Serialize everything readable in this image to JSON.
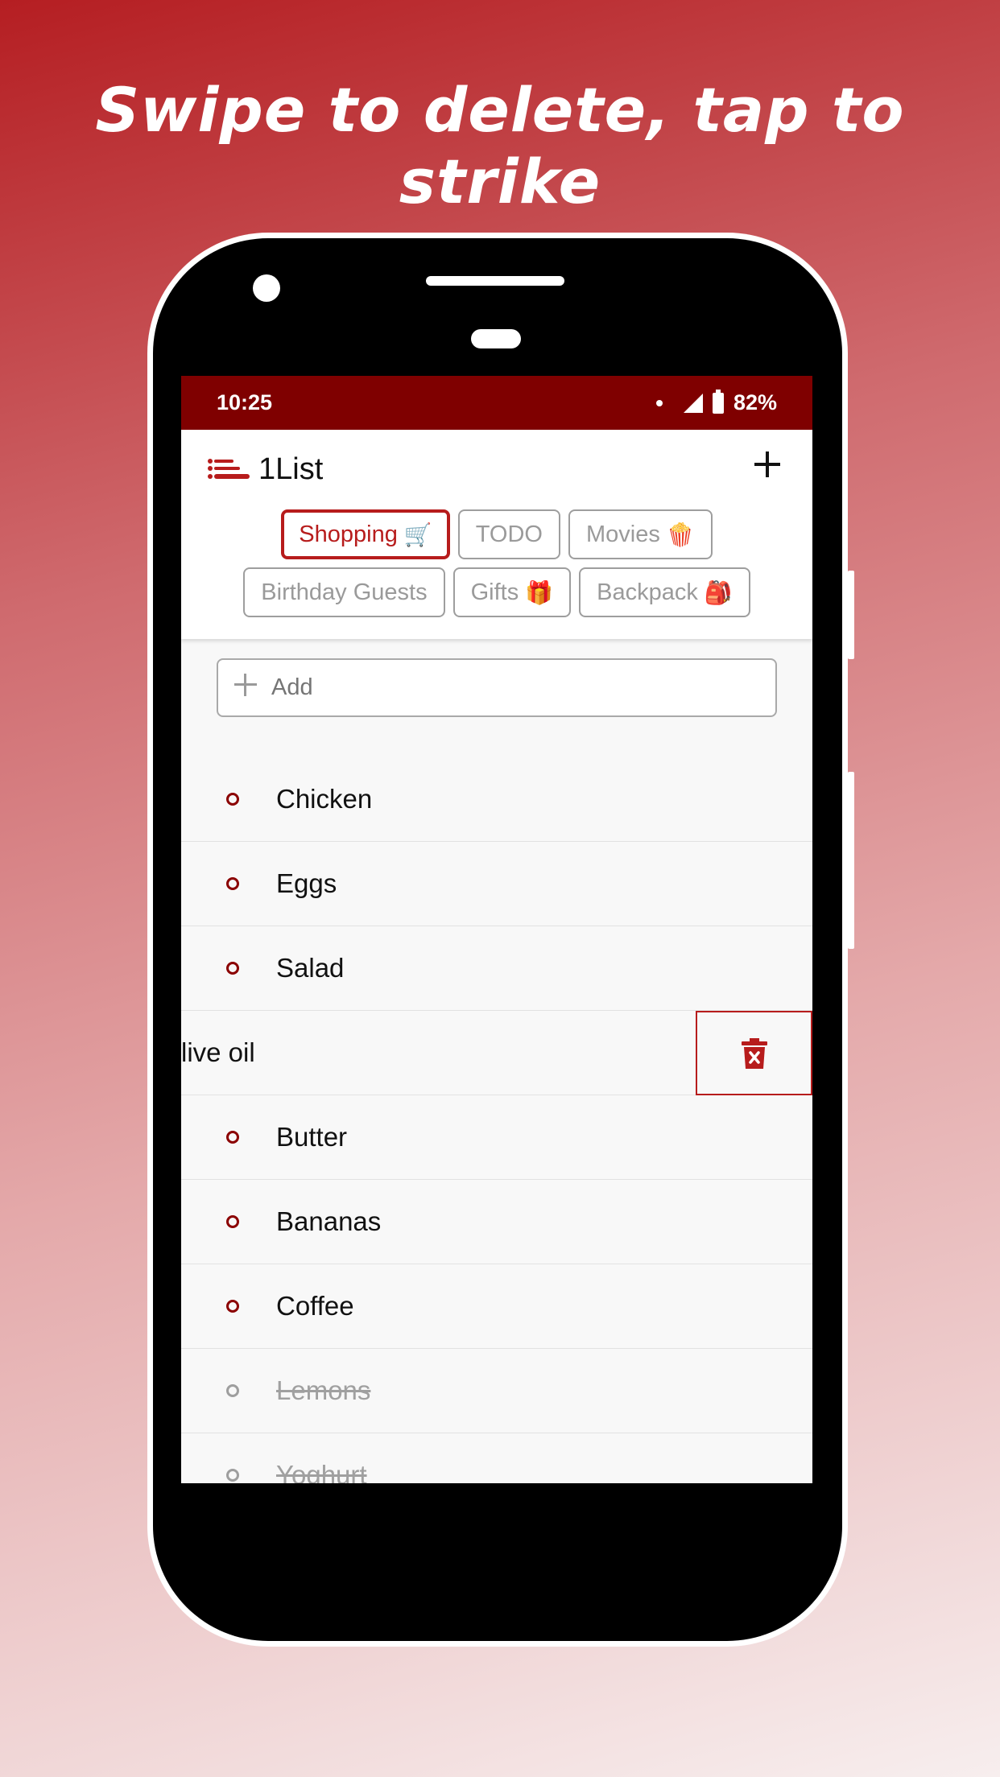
{
  "headline": "Swipe to delete, tap to strike",
  "status_bar": {
    "time": "10:25",
    "battery": "82%"
  },
  "app": {
    "title": "1List",
    "add_icon": "plus-icon",
    "logo_icon": "list-logo-icon"
  },
  "tabs": [
    {
      "label": "Shopping",
      "emoji": "🛒",
      "active": true
    },
    {
      "label": "TODO",
      "emoji": ""
    },
    {
      "label": "Movies",
      "emoji": "🍿"
    },
    {
      "label": "Birthday Guests",
      "emoji": ""
    },
    {
      "label": "Gifts",
      "emoji": "🎁"
    },
    {
      "label": "Backpack",
      "emoji": "🎒"
    }
  ],
  "add_field": {
    "placeholder": "Add"
  },
  "items": [
    {
      "label": "Chicken",
      "done": false
    },
    {
      "label": "Eggs",
      "done": false
    },
    {
      "label": "Salad",
      "done": false
    },
    {
      "label": "live oil",
      "done": false,
      "swiped": true
    },
    {
      "label": "Butter",
      "done": false
    },
    {
      "label": "Bananas",
      "done": false
    },
    {
      "label": "Coffee",
      "done": false
    },
    {
      "label": "Lemons",
      "done": true
    },
    {
      "label": "Yoghurt",
      "done": true
    }
  ],
  "colors": {
    "accent": "#b71c1c",
    "status_bar": "#7f0000"
  }
}
